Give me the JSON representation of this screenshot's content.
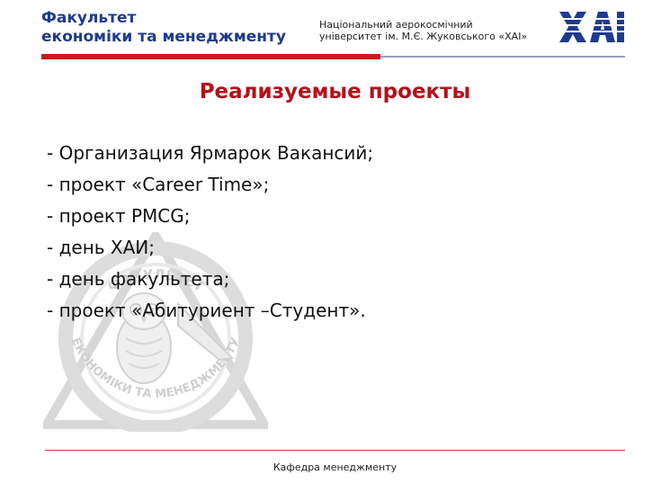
{
  "header": {
    "faculty_line1": "Факультет",
    "faculty_line2": "економіки та менеджменту",
    "university_line1": "Національний аерокосмічний",
    "university_line2": "університет ім. М.Є. Жуковського «ХАІ»",
    "logo_text": "ХАІ",
    "colors": {
      "brand_blue": "#1f3b8f",
      "accent_red": "#cc1b1b"
    }
  },
  "slide": {
    "title": "Реализуемые проекты",
    "items": [
      "- Организация Ярмарок Вакансий;",
      "- проект «Career Time»;",
      "- проект PMCG;",
      "- день ХАИ;",
      "- день факультета;",
      "- проект «Абитуриент –Студент»."
    ]
  },
  "watermark": {
    "text_top": "ФАКУЛЬТЕТ",
    "text_bottom": "ЕКОНОМІКИ ТА МЕНЕДЖМЕНТУ",
    "icon": "owl-emblem-icon"
  },
  "footer": {
    "text": "Кафедра менеджменту"
  }
}
